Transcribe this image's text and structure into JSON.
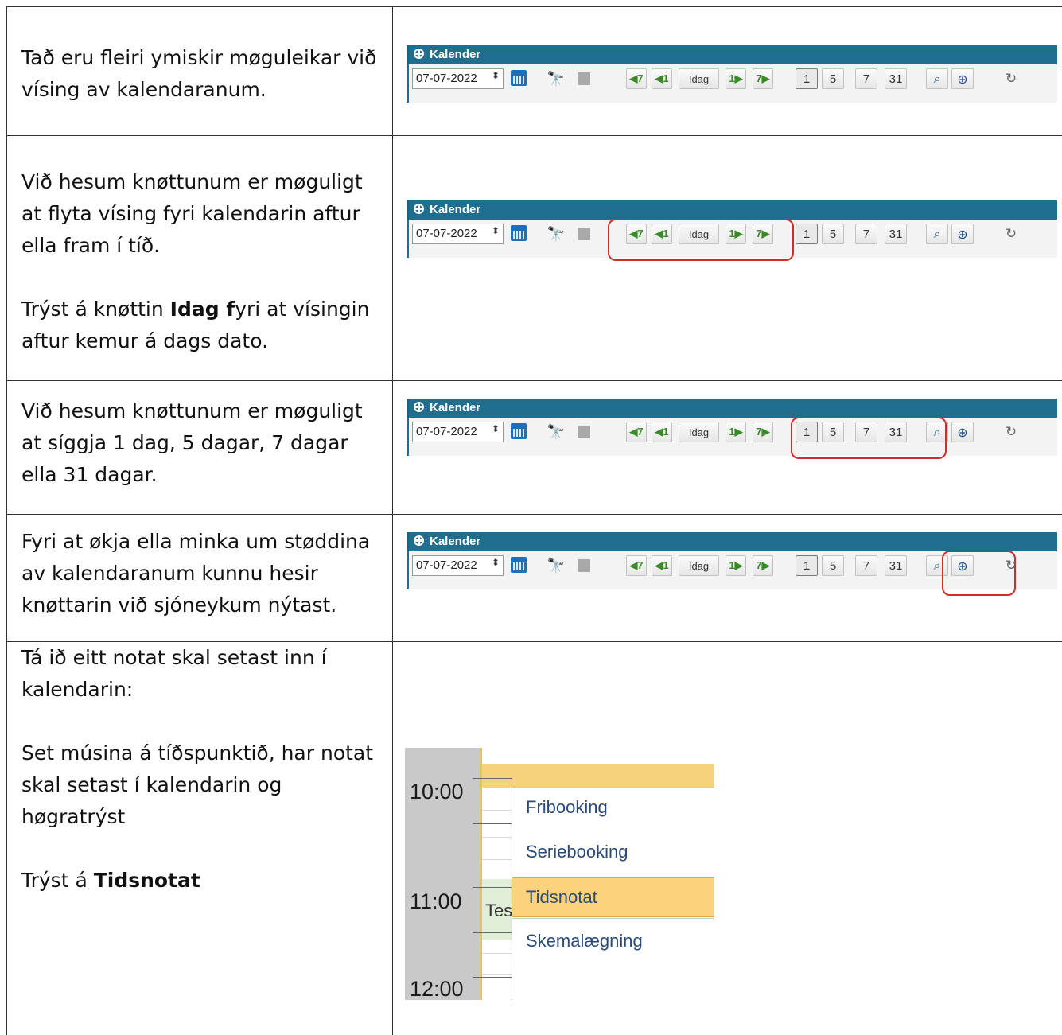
{
  "rows": [
    {
      "text": [
        "Tað eru fleiri ymiskir møguleikar við vísing av kalendaranum."
      ]
    },
    {
      "text": [
        "Við hesum knøttunum er møguligt at flyta vísing fyri kalendarin aftur ella fram í tíð."
      ],
      "text2_pre": "Trýst á knøttin ",
      "text2_bold1": "Idag f",
      "text2_post": "yri at vísingin aftur kemur á dags dato."
    },
    {
      "text": [
        "Við hesum knøttunum er møguligt at síggja 1 dag, 5 dagar, 7 dagar ella 31 dagar."
      ]
    },
    {
      "text": [
        "Fyri at økja ella minka um støddina av kalendaranum kunnu hesir knøttarin við sjóneykum nýtast."
      ]
    },
    {
      "p1": "Tá ið eitt notat skal setast inn í kalendarin:",
      "p2": "Set músina á tíðspunktið, har notat skal setast í kalendarin og høgratrýst",
      "p3_pre": "Trýst á ",
      "p3_bold": "Tidsnotat"
    }
  ],
  "toolbar": {
    "title": "Kalender",
    "date_value": "07-07-2022",
    "spin_glyph": "⬍",
    "binoculars_glyph": "🔭",
    "back7": "◀7",
    "back1": "◀1",
    "idag": "Idag",
    "fwd1": "1▶",
    "fwd7": "7▶",
    "day1": "1",
    "day5": "5",
    "day7": "7",
    "day31": "31",
    "zoom_out": "⌕",
    "zoom_in": "⊕",
    "refresh": "↻",
    "accent_color": "#1f6d8f",
    "highlight_color": "#d42a2a"
  },
  "context_menu": {
    "times": [
      "10:00",
      "11:00",
      "12:00"
    ],
    "event_text": "Tes",
    "items": [
      "Fribooking",
      "Seriebooking",
      "Tidsnotat",
      "Skemalægning"
    ],
    "selected": "Tidsnotat"
  }
}
